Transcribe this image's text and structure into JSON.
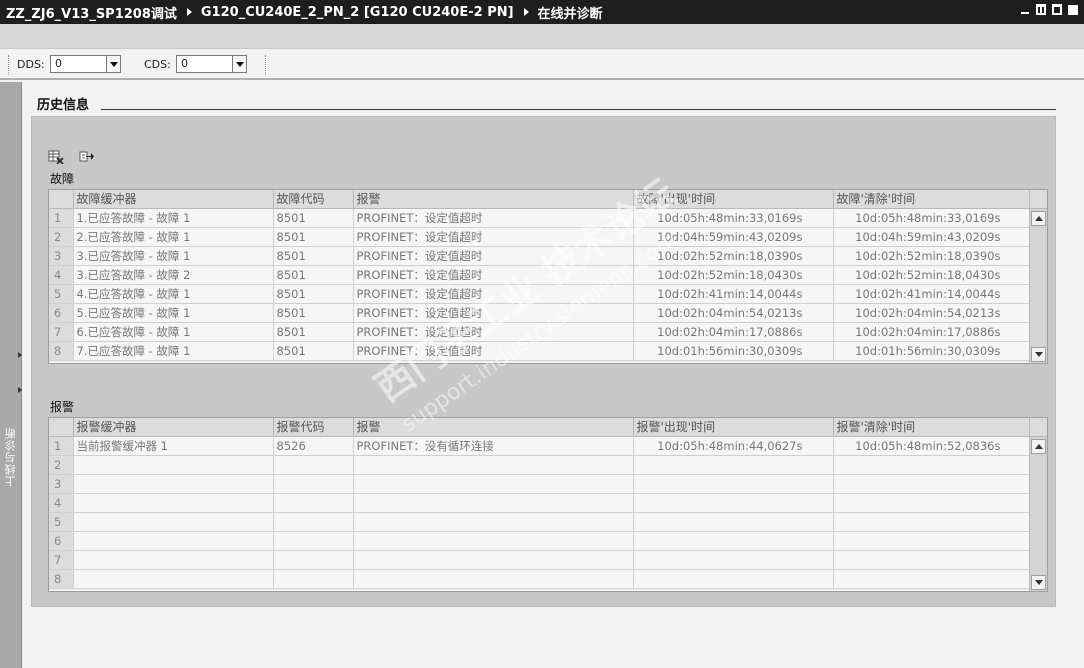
{
  "titlebar": {
    "crumbs": [
      "ZZ_ZJ6_V13_SP1208调试",
      "G120_CU240E_2_PN_2 [G120 CU240E-2 PN]",
      "在线并诊断"
    ]
  },
  "toolbar": {
    "dds_label": "DDS:",
    "dds_value": "0",
    "cds_label": "CDS:",
    "cds_value": "0"
  },
  "sidetab": {
    "label": "上线与诊断"
  },
  "section": {
    "title": "历史信息"
  },
  "faults": {
    "group_label": "故障",
    "columns": [
      "故障缓冲器",
      "故障代码",
      "报警",
      "故障'出现'时间",
      "故障'清除'时间"
    ],
    "rows": [
      {
        "idx": "1",
        "buffer": "1.已应答故障 - 故障 1",
        "code": "8501",
        "msg": "PROFINET：设定值超时",
        "occurred": "10d:05h:48min:33,0169s",
        "cleared": "10d:05h:48min:33,0169s"
      },
      {
        "idx": "2",
        "buffer": "2.已应答故障 - 故障 1",
        "code": "8501",
        "msg": "PROFINET：设定值超时",
        "occurred": "10d:04h:59min:43,0209s",
        "cleared": "10d:04h:59min:43,0209s"
      },
      {
        "idx": "3",
        "buffer": "3.已应答故障 - 故障 1",
        "code": "8501",
        "msg": "PROFINET：设定值超时",
        "occurred": "10d:02h:52min:18,0390s",
        "cleared": "10d:02h:52min:18,0390s"
      },
      {
        "idx": "4",
        "buffer": "3.已应答故障 - 故障 2",
        "code": "8501",
        "msg": "PROFINET：设定值超时",
        "occurred": "10d:02h:52min:18,0430s",
        "cleared": "10d:02h:52min:18,0430s"
      },
      {
        "idx": "5",
        "buffer": "4.已应答故障 - 故障 1",
        "code": "8501",
        "msg": "PROFINET：设定值超时",
        "occurred": "10d:02h:41min:14,0044s",
        "cleared": "10d:02h:41min:14,0044s"
      },
      {
        "idx": "6",
        "buffer": "5.已应答故障 - 故障 1",
        "code": "8501",
        "msg": "PROFINET：设定值超时",
        "occurred": "10d:02h:04min:54,0213s",
        "cleared": "10d:02h:04min:54,0213s"
      },
      {
        "idx": "7",
        "buffer": "6.已应答故障 - 故障 1",
        "code": "8501",
        "msg": "PROFINET：设定值超时",
        "occurred": "10d:02h:04min:17,0886s",
        "cleared": "10d:02h:04min:17,0886s"
      },
      {
        "idx": "8",
        "buffer": "7.已应答故障 - 故障 1",
        "code": "8501",
        "msg": "PROFINET：设定值超时",
        "occurred": "10d:01h:56min:30,0309s",
        "cleared": "10d:01h:56min:30,0309s"
      }
    ]
  },
  "alarms": {
    "group_label": "报警",
    "columns": [
      "报警缓冲器",
      "报警代码",
      "报警",
      "报警'出现'时间",
      "报警'清除'时间"
    ],
    "rows": [
      {
        "idx": "1",
        "buffer": "当前报警缓冲器 1",
        "code": "8526",
        "msg": "PROFINET：没有循环连接",
        "occurred": "10d:05h:48min:44,0627s",
        "cleared": "10d:05h:48min:52,0836s"
      },
      {
        "idx": "2",
        "buffer": "",
        "code": "",
        "msg": "",
        "occurred": "",
        "cleared": ""
      },
      {
        "idx": "3",
        "buffer": "",
        "code": "",
        "msg": "",
        "occurred": "",
        "cleared": ""
      },
      {
        "idx": "4",
        "buffer": "",
        "code": "",
        "msg": "",
        "occurred": "",
        "cleared": ""
      },
      {
        "idx": "5",
        "buffer": "",
        "code": "",
        "msg": "",
        "occurred": "",
        "cleared": ""
      },
      {
        "idx": "6",
        "buffer": "",
        "code": "",
        "msg": "",
        "occurred": "",
        "cleared": ""
      },
      {
        "idx": "7",
        "buffer": "",
        "code": "",
        "msg": "",
        "occurred": "",
        "cleared": ""
      },
      {
        "idx": "8",
        "buffer": "",
        "code": "",
        "msg": "",
        "occurred": "",
        "cleared": ""
      }
    ]
  },
  "watermark": {
    "line1": "西门子工业  技术论坛",
    "line2": "support.industry.siemens.com"
  },
  "icons": {
    "delete": "table-delete-icon",
    "export": "export-icon"
  }
}
